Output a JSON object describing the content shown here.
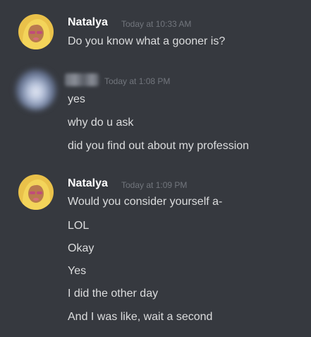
{
  "groups": [
    {
      "author": "Natalya",
      "timestamp": "Today at 10:33 AM",
      "messages": [
        "Do you know what a gooner is?"
      ]
    },
    {
      "author": "",
      "timestamp": "Today at 1:08 PM",
      "messages": [
        "yes",
        "why do u ask",
        "did you find out about my profession"
      ]
    },
    {
      "author": "Natalya",
      "timestamp": "Today at 1:09 PM",
      "messages": [
        "Would you consider yourself a-",
        "LOL",
        "Okay",
        "Yes",
        "I did the other day",
        "And I was like, wait a second"
      ]
    }
  ],
  "colors": {
    "background": "#36393f",
    "author": "#ffffff",
    "timestamp": "#72767d",
    "message": "#dcddde"
  }
}
